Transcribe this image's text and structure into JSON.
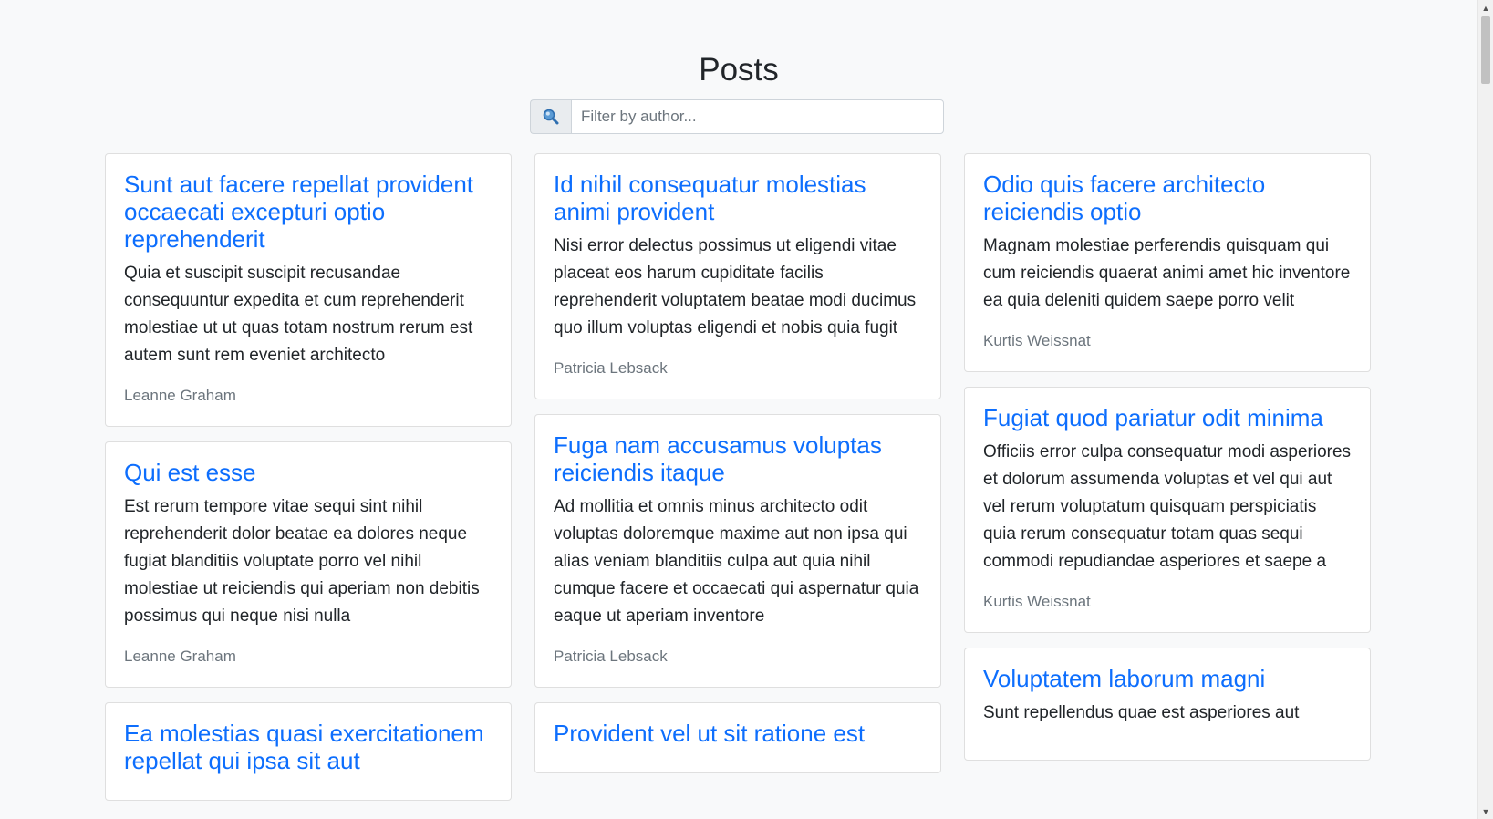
{
  "header": {
    "title": "Posts"
  },
  "search": {
    "icon": "search-icon",
    "placeholder": "Filter by author...",
    "value": ""
  },
  "colors": {
    "link": "#0d6efd",
    "muted": "#6c757d",
    "background": "#f8f9fa"
  },
  "columns": [
    {
      "posts": [
        {
          "title": "Sunt aut facere repellat provident occaecati excepturi optio reprehenderit",
          "body": "Quia et suscipit suscipit recusandae consequuntur expedita et cum reprehenderit molestiae ut ut quas totam nostrum rerum est autem sunt rem eveniet architecto",
          "author": "Leanne Graham"
        },
        {
          "title": "Qui est esse",
          "body": "Est rerum tempore vitae sequi sint nihil reprehenderit dolor beatae ea dolores neque fugiat blanditiis voluptate porro vel nihil molestiae ut reiciendis qui aperiam non debitis possimus qui neque nisi nulla",
          "author": "Leanne Graham"
        },
        {
          "title": "Ea molestias quasi exercitationem repellat qui ipsa sit aut",
          "body": "",
          "author": ""
        }
      ]
    },
    {
      "posts": [
        {
          "title": "Id nihil consequatur molestias animi provident",
          "body": "Nisi error delectus possimus ut eligendi vitae placeat eos harum cupiditate facilis reprehenderit voluptatem beatae modi ducimus quo illum voluptas eligendi et nobis quia fugit",
          "author": "Patricia Lebsack"
        },
        {
          "title": "Fuga nam accusamus voluptas reiciendis itaque",
          "body": "Ad mollitia et omnis minus architecto odit voluptas doloremque maxime aut non ipsa qui alias veniam blanditiis culpa aut quia nihil cumque facere et occaecati qui aspernatur quia eaque ut aperiam inventore",
          "author": "Patricia Lebsack"
        },
        {
          "title": "Provident vel ut sit ratione est",
          "body": "",
          "author": ""
        }
      ]
    },
    {
      "posts": [
        {
          "title": "Odio quis facere architecto reiciendis optio",
          "body": "Magnam molestiae perferendis quisquam qui cum reiciendis quaerat animi amet hic inventore ea quia deleniti quidem saepe porro velit",
          "author": "Kurtis Weissnat"
        },
        {
          "title": "Fugiat quod pariatur odit minima",
          "body": "Officiis error culpa consequatur modi asperiores et dolorum assumenda voluptas et vel qui aut vel rerum voluptatum quisquam perspiciatis quia rerum consequatur totam quas sequi commodi repudiandae asperiores et saepe a",
          "author": "Kurtis Weissnat"
        },
        {
          "title": "Voluptatem laborum magni",
          "body": "Sunt repellendus quae est asperiores aut",
          "author": ""
        }
      ]
    }
  ]
}
